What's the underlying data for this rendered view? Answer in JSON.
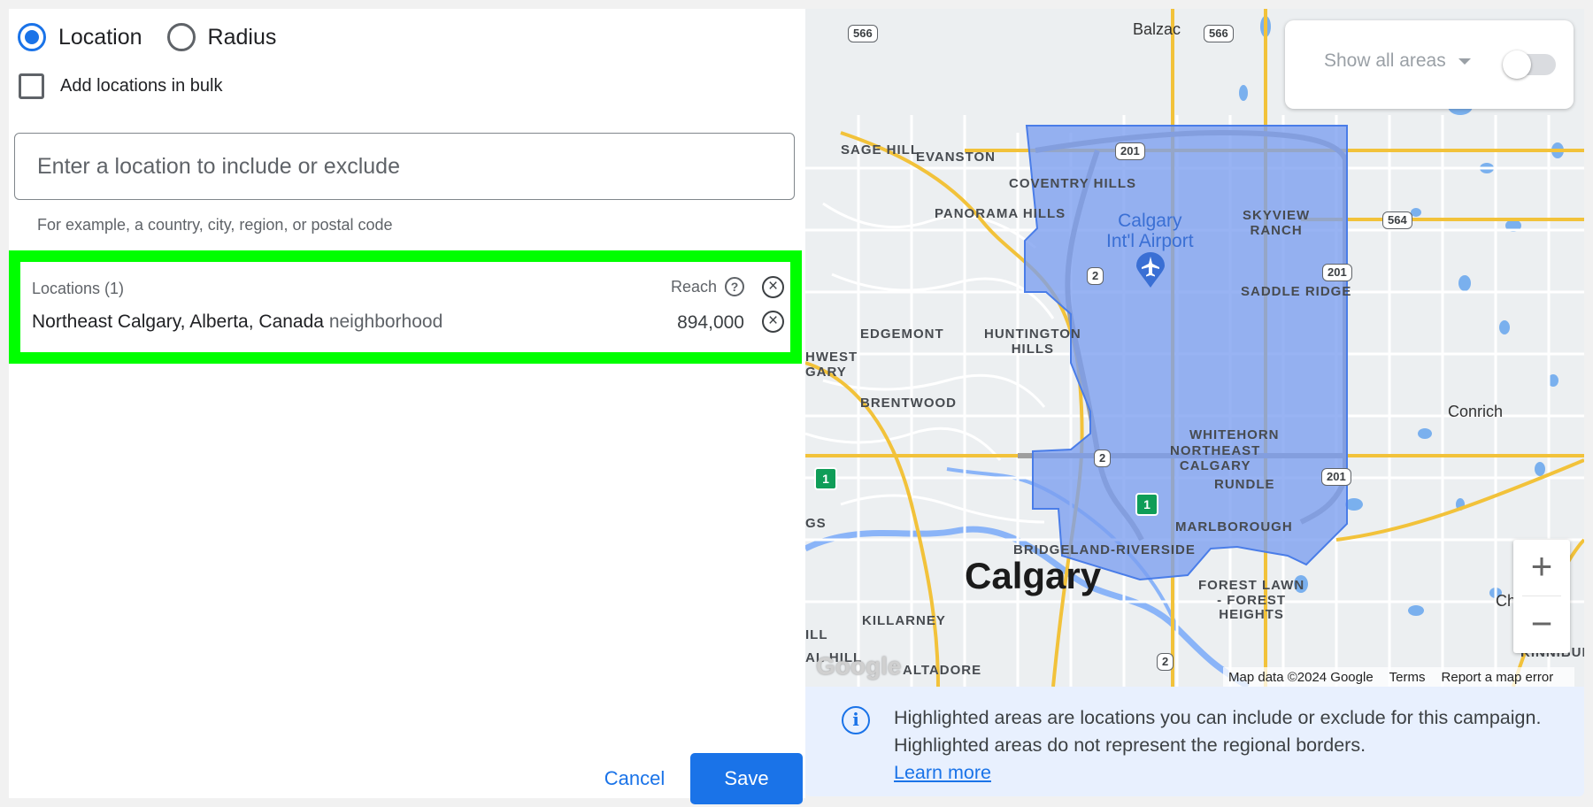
{
  "targeting": {
    "location_option": "Location",
    "radius_option": "Radius",
    "bulk_label": "Add locations in bulk"
  },
  "search": {
    "placeholder": "Enter a location to include or exclude",
    "hint": "For example, a country, city, region, or postal code"
  },
  "locations": {
    "header": "Locations (1)",
    "reach_label": "Reach",
    "items": [
      {
        "name": "Northeast Calgary, Alberta, Canada",
        "type": "neighborhood",
        "reach": "894,000"
      }
    ]
  },
  "actions": {
    "cancel": "Cancel",
    "save": "Save"
  },
  "map": {
    "show_areas": "Show all areas",
    "show_areas_enabled": false,
    "labels": {
      "balzac": "Balzac",
      "sage_hill": "SAGE HILL",
      "evanston": "EVANSTON",
      "coventry_hills": "COVENTRY HILLS",
      "panorama_hills": "PANORAMA HILLS",
      "airport_line1": "Calgary",
      "airport_line2": "Int'l Airport",
      "skyview_line1": "SKYVIEW",
      "skyview_line2": "RANCH",
      "saddle_ridge": "SADDLE RIDGE",
      "edgemont": "EDGEMONT",
      "huntington_line1": "HUNTINGTON",
      "huntington_line2": "HILLS",
      "hwest_line1": "HWEST",
      "hwest_line2": "GARY",
      "brentwood": "BRENTWOOD",
      "conrich": "Conrich",
      "whitehorn": "WHITEHORN",
      "northeast_line1": "NORTHEAST",
      "northeast_line2": "CALGARY",
      "rundle": "RUNDLE",
      "marlborough": "MARLBOROUGH",
      "gs": "GS",
      "bridgeland": "BRIDGELAND-RIVERSIDE",
      "calgary": "Calgary",
      "forest_line1": "FOREST LAWN",
      "forest_line2": "- FOREST",
      "forest_line3": "HEIGHTS",
      "killarney": "KILLARNEY",
      "ill": "ILL",
      "al_hill": "AL HILL",
      "altadore": "ALTADORE",
      "chesterm": "Chesterm",
      "kinnibur": "KINNIBUR"
    },
    "shields": {
      "s566a": "566",
      "s566b": "566",
      "s201a": "201",
      "s201b": "201",
      "s201c": "201",
      "s564": "564",
      "s2a": "2",
      "s2b": "2",
      "s2c": "2",
      "h1a": "1",
      "h1b": "1"
    },
    "zoom_in": "+",
    "zoom_out": "−",
    "logo": "Google",
    "attribution": {
      "data": "Map data ©2024 Google",
      "terms": "Terms",
      "report": "Report a map error"
    },
    "highlight_color": "#7b9ef0"
  },
  "info": {
    "text": "Highlighted areas are locations you can include or exclude for this campaign. Highlighted areas do not represent the regional borders.",
    "link": "Learn more"
  }
}
